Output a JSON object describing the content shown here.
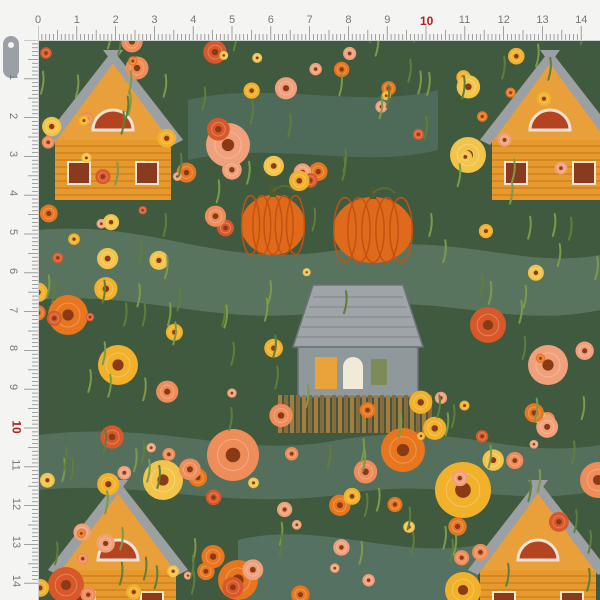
{
  "ruler": {
    "top_labels": [
      "0",
      "1",
      "2",
      "3",
      "4",
      "5",
      "6",
      "7",
      "8",
      "9",
      "10",
      "11",
      "12",
      "13",
      "14"
    ],
    "left_labels": [
      "1",
      "2",
      "3",
      "4",
      "5",
      "6",
      "7",
      "8",
      "9",
      "10",
      "11",
      "12",
      "13",
      "14"
    ],
    "accent_label": "10",
    "label_color": "#777777",
    "accent_color": "#b02020"
  },
  "fabric": {
    "description_colors": {
      "background": "#3f5a3e",
      "path": "#5e7a68",
      "pumpkin": "#e06a1c",
      "house": "#e69a2e",
      "roof_grey": "#8f9598",
      "flower_orange": "#e8761e",
      "flower_yellow": "#f2b12a",
      "flower_peach": "#f0a07a"
    },
    "icons": [
      "cottage-icon",
      "pumpkin-icon",
      "stone-house-icon",
      "flower-icon"
    ]
  }
}
